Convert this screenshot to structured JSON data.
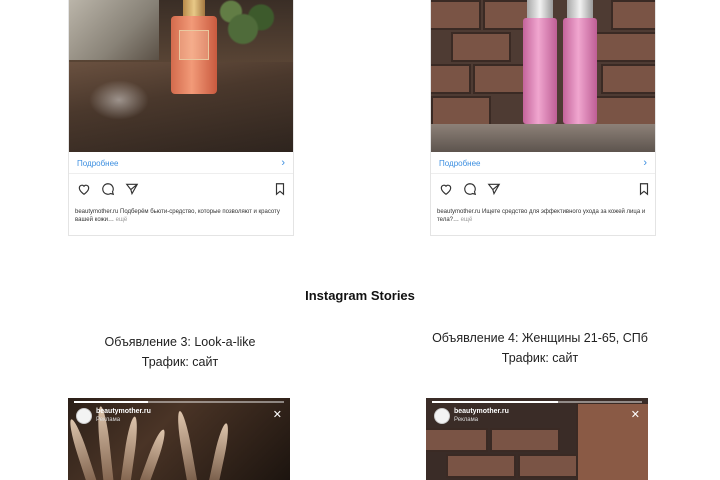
{
  "cards": [
    {
      "more_label": "Подробнее",
      "chevron": "›",
      "caption": "beautymother.ru Подберём бьюти-средство, которые позволяют и красоту вашей кожи…",
      "more_link": "ещё"
    },
    {
      "more_label": "Подробнее",
      "chevron": "›",
      "caption": "beautymother.ru Ищете средство для эффективного ухода за кожей лица и тела?…",
      "more_link": "ещё"
    }
  ],
  "icons": [
    "heart-icon",
    "comment-icon",
    "share-icon",
    "bookmark-icon",
    "close-icon"
  ],
  "section_title": "Instagram Stories",
  "ads": [
    {
      "line1": "Объявление 3: Look-a-like",
      "line2": "Трафик: сайт"
    },
    {
      "line1": "Объявление 4: Женщины 21-65, СПб",
      "line2": "Трафик: сайт"
    }
  ],
  "stories": [
    {
      "username": "beautymother.ru",
      "sponsored": "Реклама",
      "close": "✕",
      "progress": 0.35
    },
    {
      "username": "beautymother.ru",
      "sponsored": "Реклама",
      "close": "✕",
      "progress": 0.6
    }
  ],
  "colors": {
    "link_blue": "#3d8fe0"
  }
}
